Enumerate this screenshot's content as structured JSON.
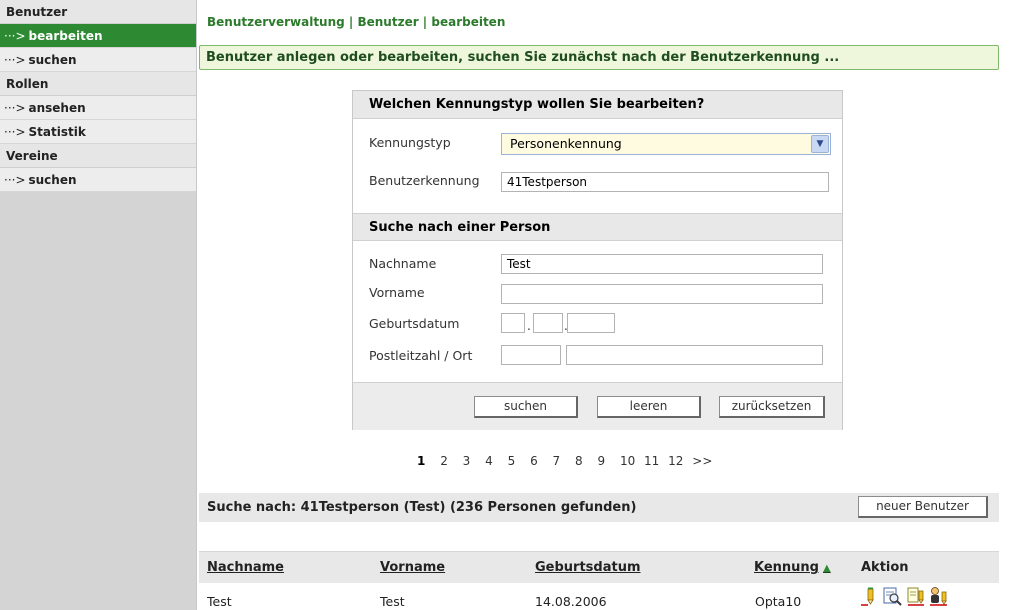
{
  "sidebar": {
    "sections": [
      {
        "title": "Benutzer",
        "items": [
          "bearbeiten",
          "suchen"
        ]
      },
      {
        "title": "Rollen",
        "items": [
          "ansehen",
          "Statistik"
        ]
      },
      {
        "title": "Vereine",
        "items": [
          "suchen"
        ]
      }
    ],
    "arrow": "···>"
  },
  "breadcrumb": "Benutzerverwaltung | Benutzer | bearbeiten",
  "banner": "Benutzer anlegen oder bearbeiten, suchen Sie zunächst nach der Benutzerkennung ...",
  "form": {
    "section1_title": "Welchen Kennungstyp wollen Sie bearbeiten?",
    "kennungstyp_label": "Kennungstyp",
    "kennungstyp_value": "Personenkennung",
    "benutzerkennung_label": "Benutzerkennung",
    "benutzerkennung_value": "41Testperson",
    "section2_title": "Suche nach einer Person",
    "nachname_label": "Nachname",
    "nachname_value": "Test",
    "vorname_label": "Vorname",
    "vorname_value": "",
    "geburtsdatum_label": "Geburtsdatum",
    "plz_ort_label": "Postleitzahl / Ort",
    "btn_suchen": "suchen",
    "btn_leeren": "leeren",
    "btn_zuruecksetzen": "zurücksetzen"
  },
  "pagination": {
    "pages": [
      "1",
      "2",
      "3",
      "4",
      "5",
      "6",
      "7",
      "8",
      "9",
      "10",
      "11",
      "12"
    ],
    "current": "1",
    "next": ">>"
  },
  "results": {
    "summary": "Suche nach: 41Testperson (Test) (236 Personen gefunden)",
    "new_user_button": "neuer Benutzer",
    "columns": {
      "nachname": "Nachname",
      "vorname": "Vorname",
      "geburtsdatum": "Geburtsdatum",
      "kennung": "Kennung",
      "aktion": "Aktion"
    },
    "rows": [
      {
        "nachname": "Test",
        "vorname": "Test",
        "geburtsdatum": "14.08.2006",
        "kennung": "Opta10"
      }
    ]
  },
  "colors": {
    "accent_green": "#2d8a33",
    "banner_bg": "#eef7dc",
    "select_bg": "#fffbe0"
  },
  "icons": [
    "edit-icon",
    "view-icon",
    "copy-icon",
    "user-icon"
  ]
}
